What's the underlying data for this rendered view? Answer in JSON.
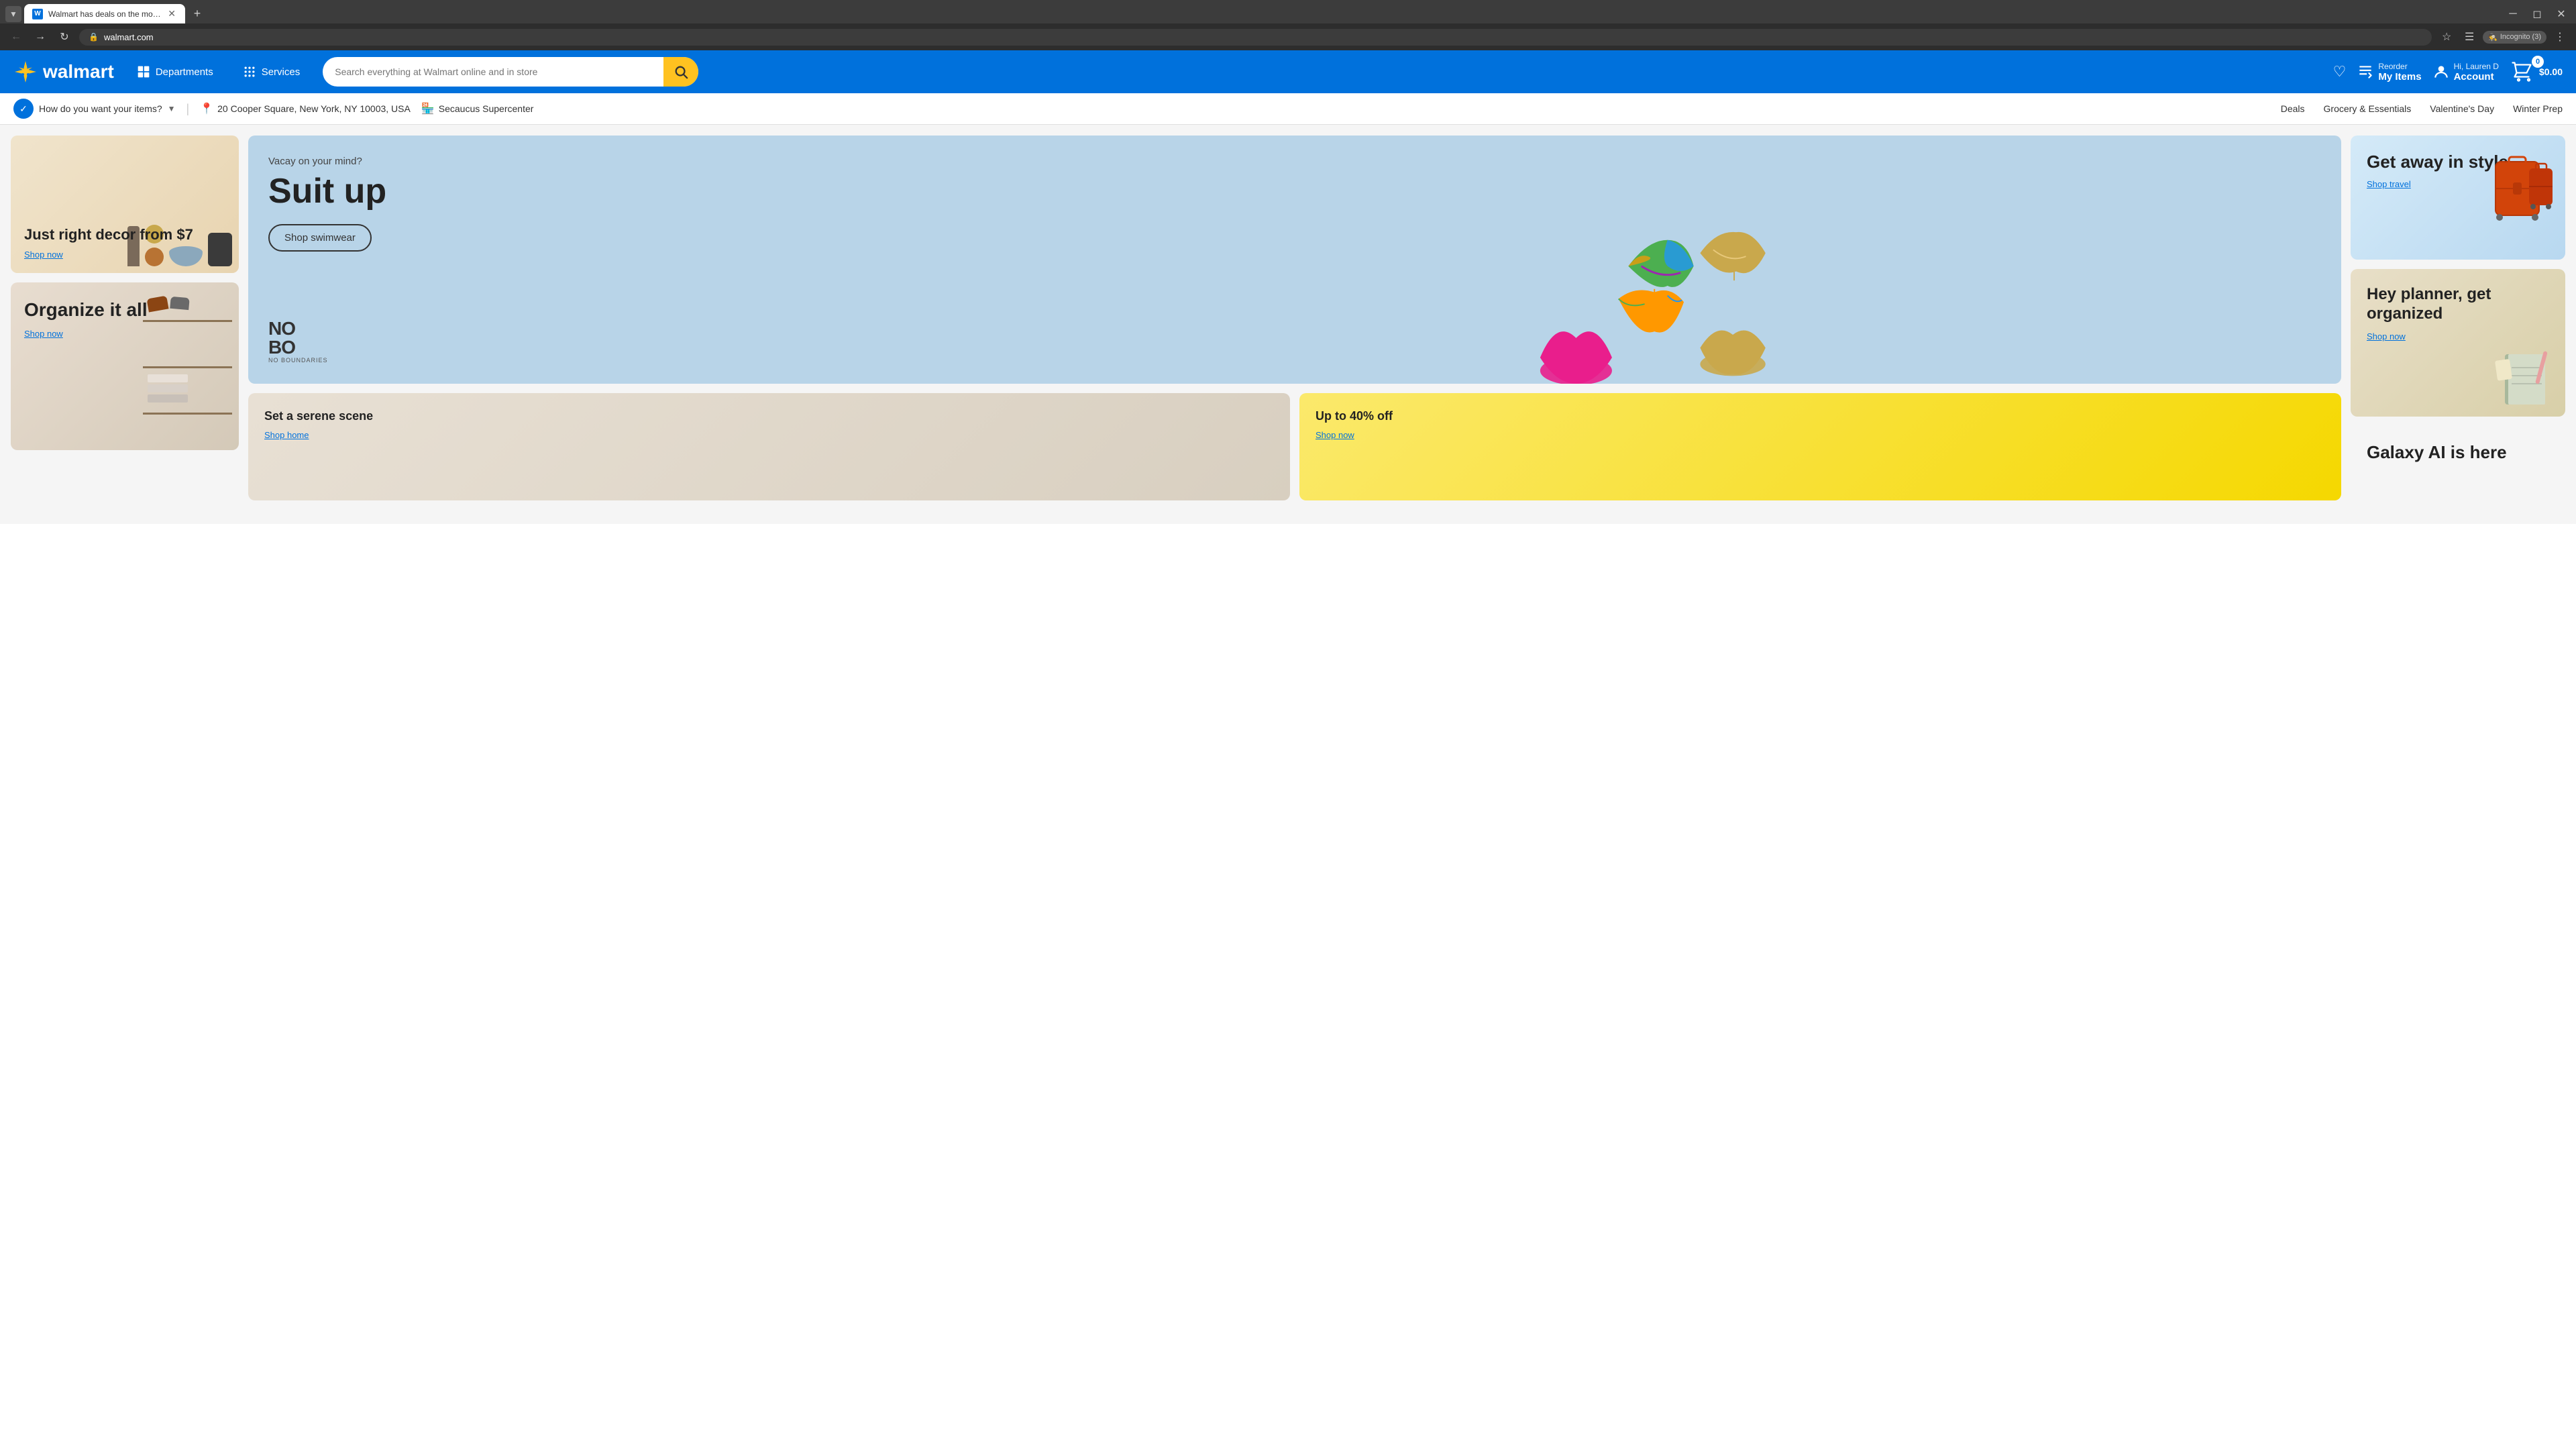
{
  "browser": {
    "tab_title": "Walmart has deals on the mos...",
    "url": "walmart.com",
    "incognito_label": "Incognito (3)"
  },
  "header": {
    "logo_text": "walmart",
    "departments_label": "Departments",
    "services_label": "Services",
    "search_placeholder": "Search everything at Walmart online and in store",
    "reorder_label": "Reorder",
    "my_items_label": "My Items",
    "account_greeting": "Hi, Lauren D",
    "account_label": "Account",
    "cart_count": "0",
    "cart_price": "$0.00"
  },
  "delivery_bar": {
    "delivery_option_label": "How do you want your items?",
    "location_label": "20 Cooper Square, New York, NY 10003, USA",
    "store_label": "Secaucus Supercenter"
  },
  "nav_links": [
    {
      "label": "Deals"
    },
    {
      "label": "Grocery & Essentials"
    },
    {
      "label": "Valentine's Day"
    },
    {
      "label": "Winter Prep"
    }
  ],
  "promo_cards": {
    "decor": {
      "title": "Just right decor from $7",
      "cta": "Shop now"
    },
    "organize": {
      "title": "Organize it all",
      "cta": "Shop now"
    },
    "hero": {
      "subtitle": "Vacay on your mind?",
      "title": "Suit up",
      "cta": "Shop swimwear",
      "brand": "NO BO",
      "brand_sub": "NO BOUNDARIES"
    },
    "travel": {
      "title": "Get away in style",
      "cta": "Shop travel"
    },
    "planner": {
      "title": "Hey planner, get organized",
      "cta": "Shop now"
    },
    "serene": {
      "title": "Set a serene scene",
      "cta": "Shop home"
    },
    "sale": {
      "title": "Up to 40% off",
      "cta": "Shop now"
    },
    "galaxy": {
      "title": "Galaxy AI is here"
    }
  }
}
